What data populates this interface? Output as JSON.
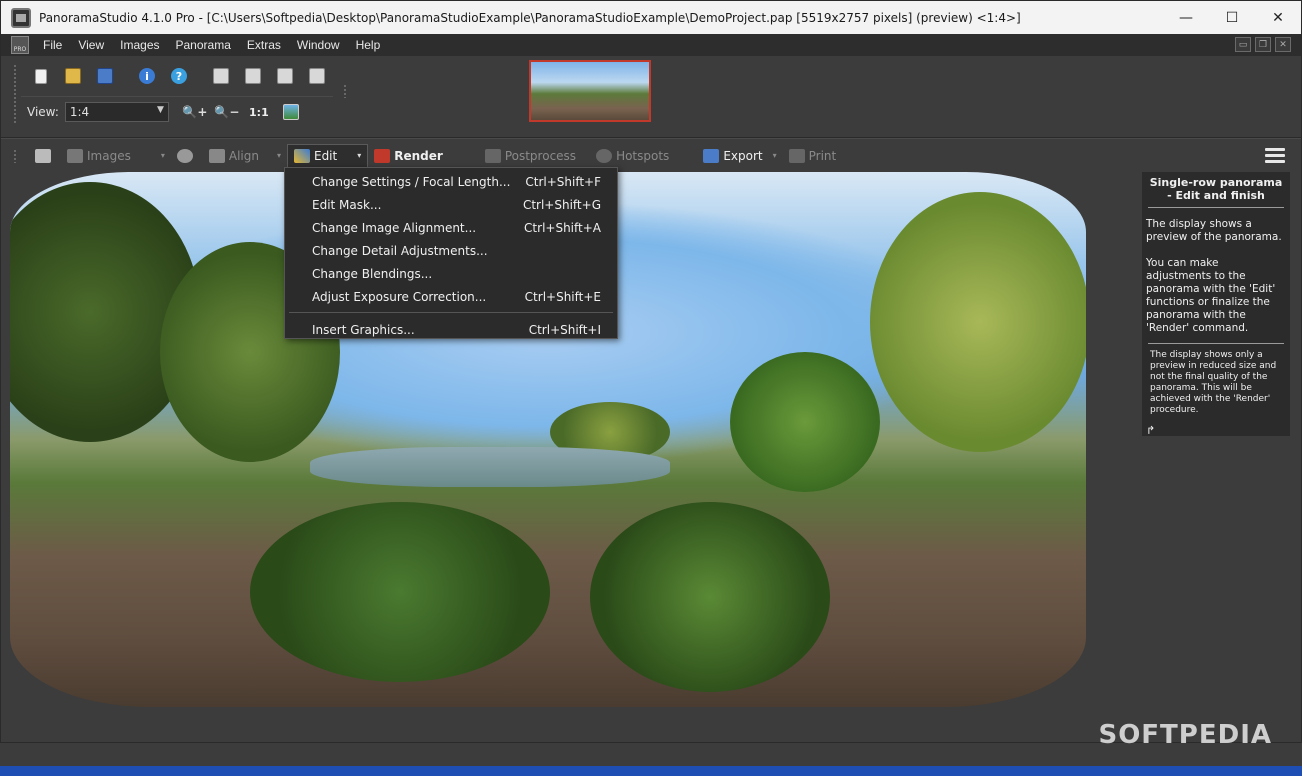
{
  "window": {
    "title": "PanoramaStudio 4.1.0 Pro - [C:\\Users\\Softpedia\\Desktop\\PanoramaStudioExample\\PanoramaStudioExample\\DemoProject.pap [5519x2757 pixels] (preview) <1:4>]",
    "controls": {
      "minimize": "—",
      "maximize": "☐",
      "close": "✕"
    }
  },
  "menubar": {
    "logo": "PRO",
    "items": [
      "File",
      "View",
      "Images",
      "Panorama",
      "Extras",
      "Window",
      "Help"
    ]
  },
  "toolbar": {
    "view_label": "View:",
    "view_value": "1:4",
    "zoom_actual_label": "1:1"
  },
  "workflow": {
    "images": "Images",
    "align": "Align",
    "edit": "Edit",
    "render": "Render",
    "postprocess": "Postprocess",
    "hotspots": "Hotspots",
    "export": "Export",
    "print": "Print"
  },
  "edit_menu": {
    "items": [
      {
        "label": "Change Settings / Focal Length...",
        "shortcut": "Ctrl+Shift+F"
      },
      {
        "label": "Edit Mask...",
        "shortcut": "Ctrl+Shift+G"
      },
      {
        "label": "Change Image Alignment...",
        "shortcut": "Ctrl+Shift+A"
      },
      {
        "label": "Change Detail Adjustments...",
        "shortcut": ""
      },
      {
        "label": "Change Blendings...",
        "shortcut": ""
      },
      {
        "label": "Adjust Exposure Correction...",
        "shortcut": "Ctrl+Shift+E"
      },
      {
        "label": "Insert Graphics...",
        "shortcut": "Ctrl+Shift+I"
      }
    ]
  },
  "sidepanel": {
    "title": "Single-row panorama - Edit and finish",
    "text1": "The display shows a preview of the panorama.",
    "text2": "You can make adjustments to the panorama with the 'Edit' functions or finalize the panorama with the 'Render' command.",
    "note": "The display shows only a preview in reduced size and not the final quality of the panorama. This will be achieved with the 'Render' procedure.",
    "arrow": "↱"
  },
  "watermark": "SOFTPEDIA",
  "colors": {
    "accent": "#c0392b",
    "panel_bg": "#3c3c3c",
    "menu_bg": "#2b2b2b"
  }
}
